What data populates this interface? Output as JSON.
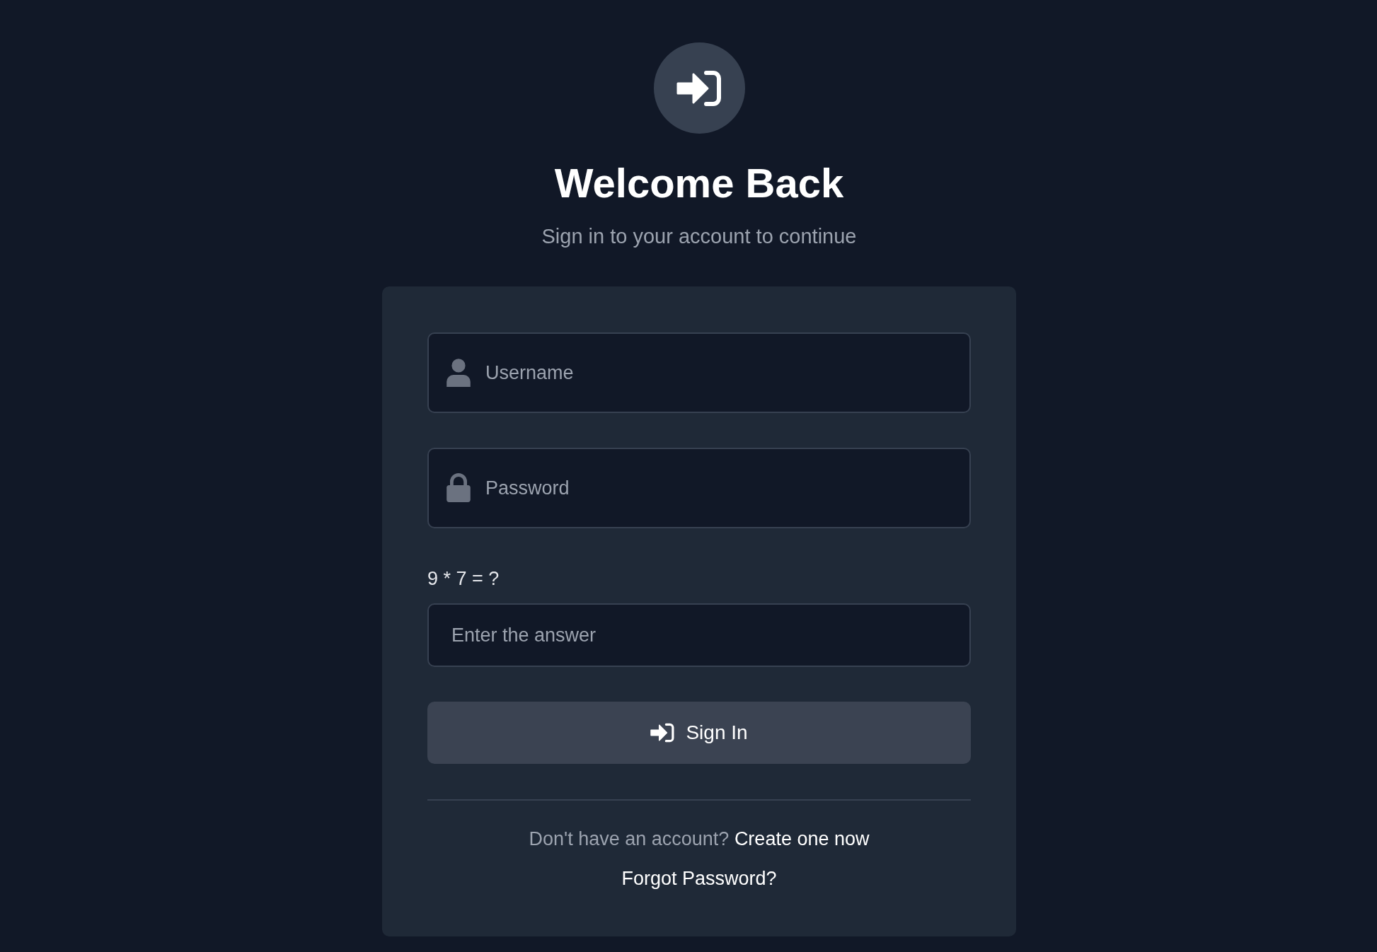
{
  "header": {
    "title": "Welcome Back",
    "subtitle": "Sign in to your account to continue"
  },
  "form": {
    "fields": [
      {
        "kind": "username",
        "placeholder": "Username"
      },
      {
        "kind": "password",
        "placeholder": "Password"
      }
    ],
    "captcha": {
      "question": "9 * 7 = ?",
      "placeholder": "Enter the answer"
    },
    "submit": "Sign In",
    "signup": {
      "prompt": "Don't have an account?",
      "link": "Create one now"
    },
    "forgot": "Forgot Password?"
  }
}
